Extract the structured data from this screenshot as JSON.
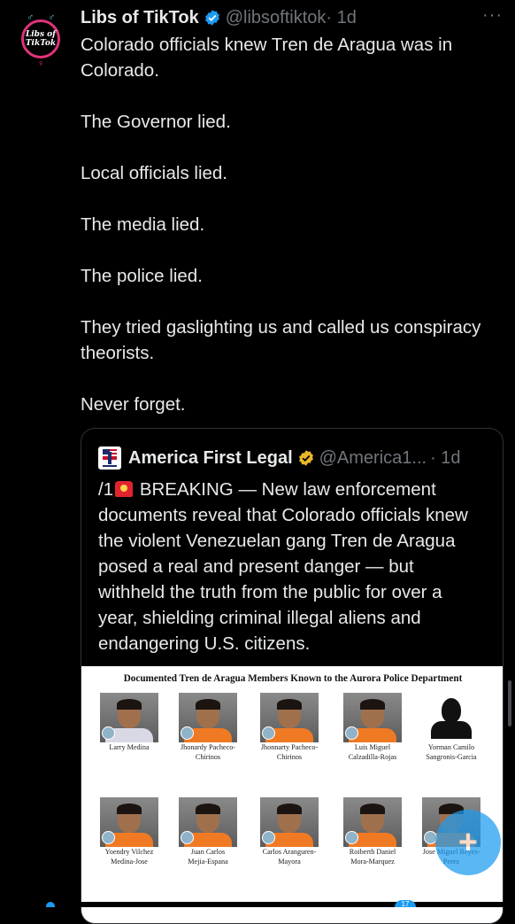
{
  "tweet": {
    "author_name": "Libs of TikTok",
    "handle": "@libsoftiktok",
    "time": "· 1d",
    "more_label": "···",
    "avatar_text": [
      "Libs of",
      "TikTok"
    ],
    "paragraphs": [
      "Colorado officials knew Tren de Aragua was in Colorado.",
      "The Governor lied.",
      "Local officials lied.",
      "The media lied.",
      "The police lied.",
      "They tried gaslighting us and called us conspiracy theorists.",
      "Never forget."
    ]
  },
  "quote": {
    "author_name": "America First Legal",
    "handle": "@America1...",
    "time": "· 1d",
    "text_prefix": "/1",
    "text": "BREAKING — New law enforcement documents reveal that Colorado officials knew the violent Venezuelan gang Tren de Aragua posed a real and present danger — but withheld the truth from the public for over a year, shielding criminal illegal aliens and endangering U.S. citizens.",
    "image": {
      "title": "Documented Tren de Aragua Members Known to the Aurora Police Department",
      "members": [
        [
          "Larry Medina",
          ""
        ],
        [
          "Jhonardy Pacheco-",
          "Chirinos"
        ],
        [
          "Jhonnarty Pacheco-",
          "Chirinos"
        ],
        [
          "Luis Miguel",
          "Calzadilla-Rojas"
        ],
        [
          "Yorman Camilo",
          "Sangronis-Garcia"
        ],
        [
          "Yoendry Vilchez",
          "Medina-Jose"
        ],
        [
          "Juan Carlos",
          "Mejia-Espana"
        ],
        [
          "Carlos Aranguren-",
          "Mayora"
        ],
        [
          "Roiberth Daniel",
          "Mora-Marquez"
        ],
        [
          "Jose Miguel Reyes-",
          "Perez"
        ]
      ]
    }
  },
  "fab_label": "+",
  "nav_badge": "17",
  "colors": {
    "accent": "#1d9bf0",
    "background": "#000000",
    "text": "#e7e9ea",
    "muted": "#71767b",
    "verified_gold": "#e8b829"
  }
}
